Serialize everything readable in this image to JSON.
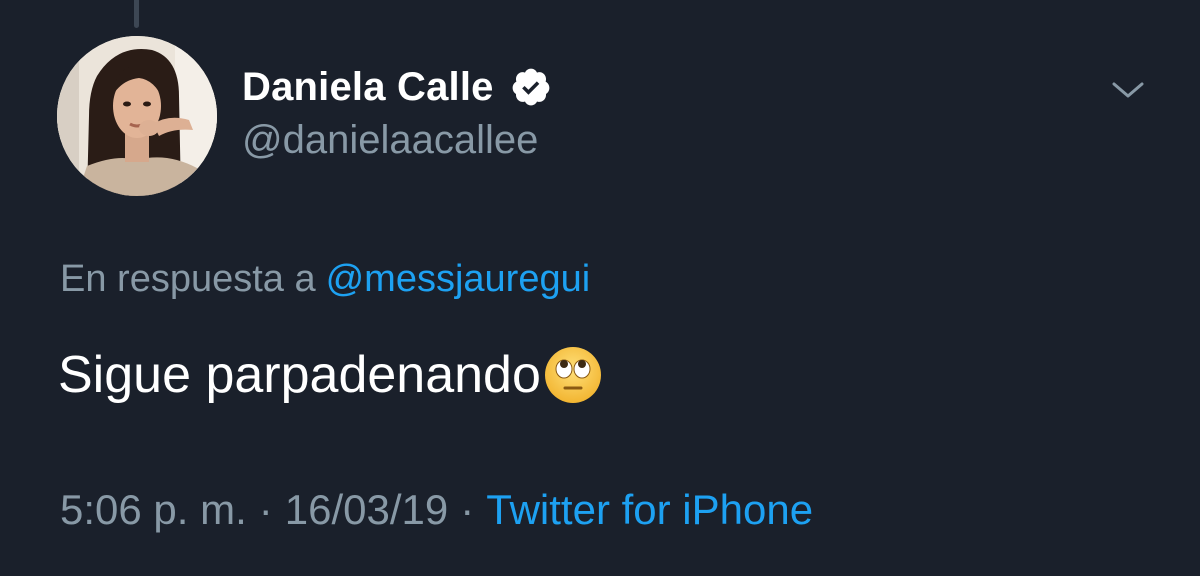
{
  "tweet": {
    "author": {
      "display_name": "Daniela Calle",
      "handle": "@danielaacallee",
      "verified": true,
      "avatar_icon": "profile-photo"
    },
    "menu_icon": "chevron-down-icon",
    "reply_to_prefix": "En respuesta a",
    "reply_to_handle": "@messjauregui",
    "text": "Sigue parpadenando",
    "emoji": "face-with-rolling-eyes",
    "time": "5:06 p. m.",
    "date": "16/03/19",
    "separator": "·",
    "source": "Twitter for iPhone"
  },
  "colors": {
    "background": "#1a202b",
    "primary_text": "#ffffff",
    "secondary_text": "#8899a6",
    "accent": "#1da1f2"
  }
}
